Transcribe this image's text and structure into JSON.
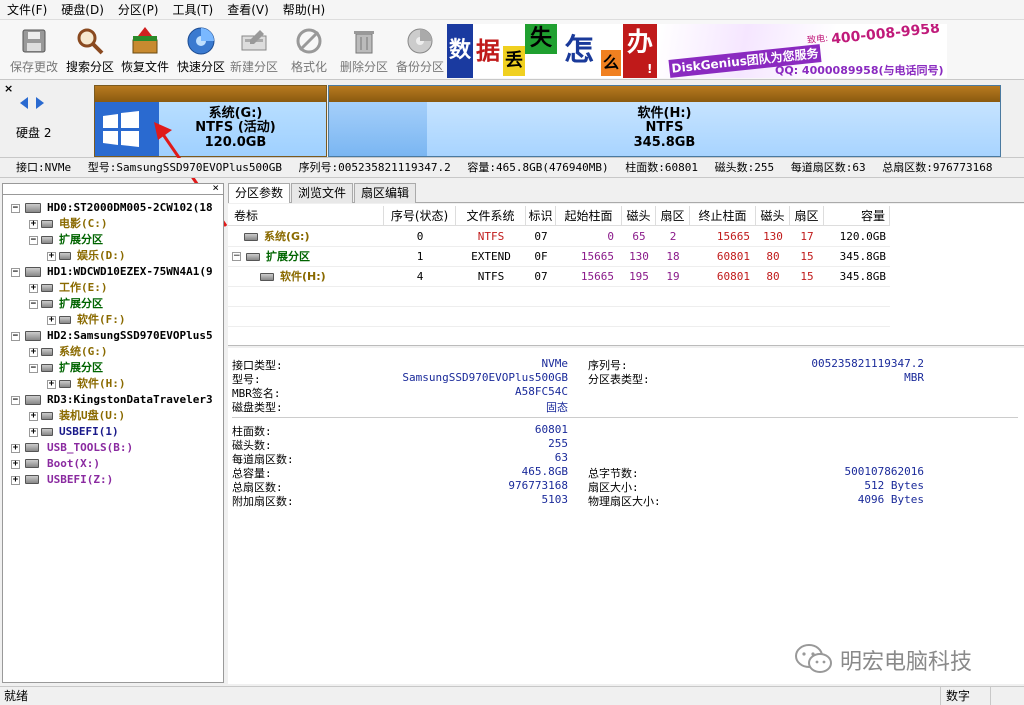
{
  "menu": [
    "文件(F)",
    "硬盘(D)",
    "分区(P)",
    "工具(T)",
    "查看(V)",
    "帮助(H)"
  ],
  "toolbar": {
    "save": "保存更改",
    "search": "搜索分区",
    "restore": "恢复文件",
    "quick": "快速分区",
    "new": "新建分区",
    "format": "格式化",
    "delete": "删除分区",
    "backup": "备份分区"
  },
  "banner": {
    "chars": [
      "数",
      "据",
      "丢",
      "失",
      "怎",
      "么",
      "办",
      "!"
    ],
    "slogan": "DiskGenius团队为您服务",
    "phone": "400-008-9958",
    "phone_prefix": "致电:",
    "qq": "QQ: 4000089958(与电话同号)"
  },
  "disk_label": "硬盘 2",
  "partitions": [
    {
      "name": "系统(G:)",
      "fs": "NTFS (活动)",
      "size": "120.0GB"
    },
    {
      "name": "软件(H:)",
      "fs": "NTFS",
      "size": "345.8GB"
    }
  ],
  "disk_info": [
    "接口:NVMe",
    "型号:SamsungSSD970EVOPlus500GB",
    "序列号:005235821119347.2",
    "容量:465.8GB(476940MB)",
    "柱面数:60801",
    "磁头数:255",
    "每道扇区数:63",
    "总扇区数:976773168"
  ],
  "tree": [
    {
      "label": "HD0:ST2000DM005-2CW102(18",
      "color": "#000"
    },
    {
      "label": "电影(C:)",
      "color": "#8a6a00"
    },
    {
      "label": "扩展分区",
      "color": "#006400"
    },
    {
      "label": "娱乐(D:)",
      "color": "#8a6a00"
    },
    {
      "label": "HD1:WDCWD10EZEX-75WN4A1(9",
      "color": "#000"
    },
    {
      "label": "工作(E:)",
      "color": "#8a6a00"
    },
    {
      "label": "扩展分区",
      "color": "#006400"
    },
    {
      "label": "软件(F:)",
      "color": "#8a6a00"
    },
    {
      "label": "HD2:SamsungSSD970EVOPlus5",
      "color": "#000"
    },
    {
      "label": "系统(G:)",
      "color": "#8a6a00"
    },
    {
      "label": "扩展分区",
      "color": "#006400"
    },
    {
      "label": "软件(H:)",
      "color": "#8a6a00"
    },
    {
      "label": "RD3:KingstonDataTraveler3",
      "color": "#000"
    },
    {
      "label": "装机U盘(U:)",
      "color": "#8a6a00"
    },
    {
      "label": "USBEFI(1)",
      "color": "#1a1a8a"
    },
    {
      "label": "USB_TOOLS(B:)",
      "color": "#8a2aa0"
    },
    {
      "label": "Boot(X:)",
      "color": "#8a2aa0"
    },
    {
      "label": "USBEFI(Z:)",
      "color": "#8a2aa0"
    }
  ],
  "tabs": [
    "分区参数",
    "浏览文件",
    "扇区编辑"
  ],
  "table": {
    "headers": [
      "卷标",
      "序号(状态)",
      "文件系统",
      "标识",
      "起始柱面",
      "磁头",
      "扇区",
      "终止柱面",
      "磁头",
      "扇区",
      "容量"
    ],
    "rows": [
      {
        "label": "系统(G:)",
        "idx": "0",
        "fs": "NTFS",
        "id": "07",
        "sc": "0",
        "sh": "65",
        "ss": "2",
        "ec": "15665",
        "eh": "130",
        "es": "17",
        "cap": "120.0GB"
      },
      {
        "label": "扩展分区",
        "idx": "1",
        "fs": "EXTEND",
        "id": "0F",
        "sc": "15665",
        "sh": "130",
        "ss": "18",
        "ec": "60801",
        "eh": "80",
        "es": "15",
        "cap": "345.8GB"
      },
      {
        "label": "软件(H:)",
        "idx": "4",
        "fs": "NTFS",
        "id": "07",
        "sc": "15665",
        "sh": "195",
        "ss": "19",
        "ec": "60801",
        "eh": "80",
        "es": "15",
        "cap": "345.8GB"
      }
    ]
  },
  "details_left": [
    {
      "k": "接口类型:",
      "v": "NVMe"
    },
    {
      "k": "型号:",
      "v": "SamsungSSD970EVOPlus500GB"
    },
    {
      "k": "MBR签名:",
      "v": "A58FC54C"
    },
    {
      "k": "磁盘类型:",
      "v": "固态"
    }
  ],
  "details_right": [
    {
      "k": "序列号:",
      "v": "005235821119347.2"
    },
    {
      "k": "分区表类型:",
      "v": "MBR"
    }
  ],
  "geom_left": [
    {
      "k": "柱面数:",
      "v": "60801"
    },
    {
      "k": "磁头数:",
      "v": "255"
    },
    {
      "k": "每道扇区数:",
      "v": "63"
    },
    {
      "k": "总容量:",
      "v": "465.8GB"
    },
    {
      "k": "总扇区数:",
      "v": "976773168"
    },
    {
      "k": "附加扇区数:",
      "v": "5103"
    }
  ],
  "geom_right": [
    {
      "k": "总字节数:",
      "v": "500107862016"
    },
    {
      "k": "扇区大小:",
      "v": "512 Bytes"
    },
    {
      "k": "物理扇区大小:",
      "v": "4096 Bytes"
    }
  ],
  "watermark": "明宏电脑科技",
  "status": {
    "left": "就绪",
    "right": "数字"
  }
}
